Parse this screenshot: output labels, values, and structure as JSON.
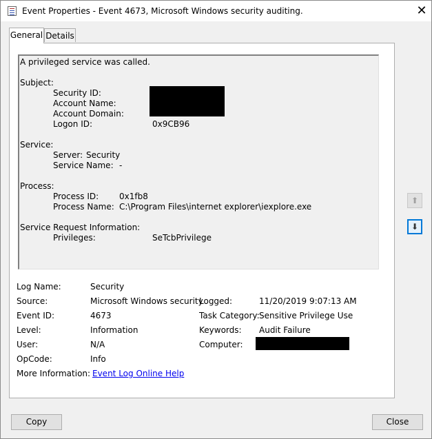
{
  "window": {
    "title": "Event Properties - Event 4673, Microsoft Windows security auditing.",
    "close_glyph": "✕",
    "icon": "event-viewer-icon"
  },
  "tabs": [
    {
      "label": "General",
      "active": true
    },
    {
      "label": "Details",
      "active": false
    }
  ],
  "message": {
    "summary": "A privileged service was called.",
    "subject_header": "Subject:",
    "security_id_label": "Security ID:",
    "account_name_label": "Account Name:",
    "account_domain_label": "Account Domain:",
    "logon_id_label": "Logon ID:",
    "logon_id_value": "0x9CB96",
    "service_header": "Service:",
    "server_label": "Server:",
    "server_value": "Security",
    "service_name_label": "Service Name:",
    "service_name_value": "-",
    "process_header": "Process:",
    "process_id_label": "Process ID:",
    "process_id_value": "0x1fb8",
    "process_name_label": "Process Name:",
    "process_name_value": "C:\\Program Files\\internet explorer\\iexplore.exe",
    "sri_header": "Service Request Information:",
    "privileges_label": "Privileges:",
    "privileges_value": "SeTcbPrivilege"
  },
  "details": {
    "log_name_label": "Log Name:",
    "log_name_value": "Security",
    "source_label": "Source:",
    "source_value": "Microsoft Windows security",
    "logged_label": "Logged:",
    "logged_value": "11/20/2019 9:07:13 AM",
    "event_id_label": "Event ID:",
    "event_id_value": "4673",
    "task_category_label": "Task Category:",
    "task_category_value": "Sensitive Privilege Use",
    "level_label": "Level:",
    "level_value": "Information",
    "keywords_label": "Keywords:",
    "keywords_value": "Audit Failure",
    "user_label": "User:",
    "user_value": "N/A",
    "computer_label": "Computer:",
    "opcode_label": "OpCode:",
    "opcode_value": "Info",
    "more_info_label": "More Information:",
    "more_info_link": "Event Log Online Help"
  },
  "nav": {
    "up_glyph": "⬆",
    "down_glyph": "⬇"
  },
  "buttons": {
    "copy": "Copy",
    "close": "Close"
  }
}
